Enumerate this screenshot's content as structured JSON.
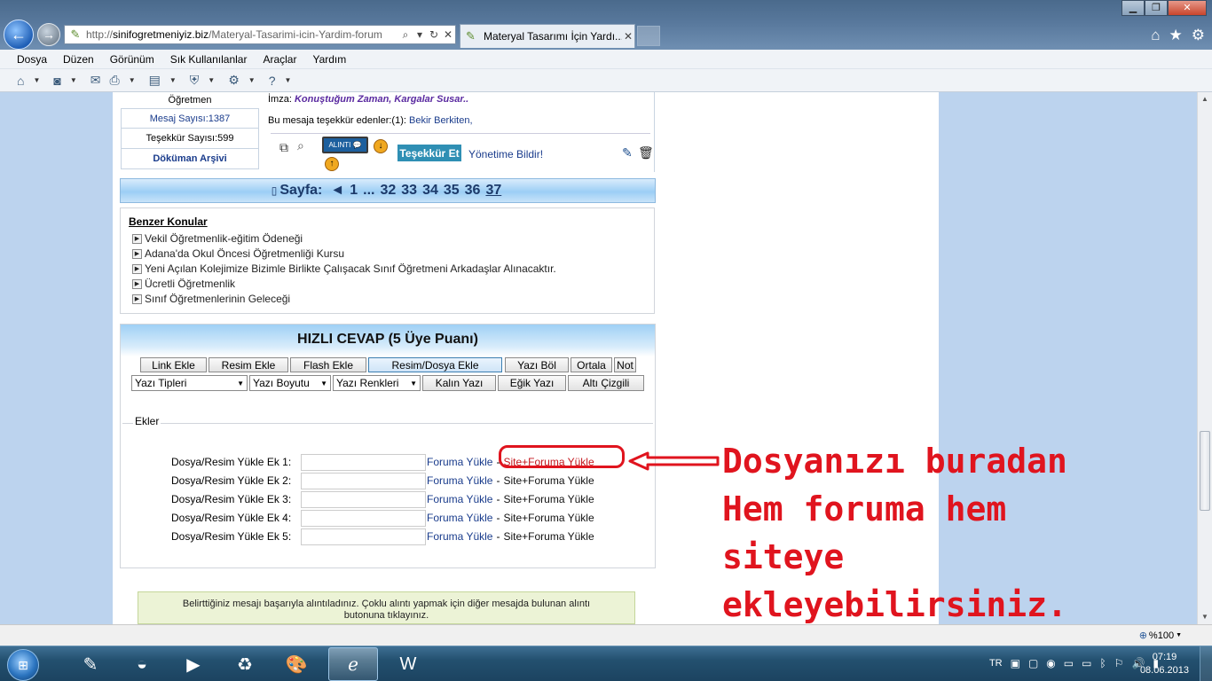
{
  "browser": {
    "url_prefix": "http://",
    "url_domain": "sinifogretmeniyiz.biz",
    "url_path": "/Materyal-Tasarimi-icin-Yardim-forum",
    "tab_title": "Materyal Tasarımı İçin Yardı...",
    "tab_close": "✕"
  },
  "menu": [
    "Dosya",
    "Düzen",
    "Görünüm",
    "Sık Kullanılanlar",
    "Araçlar",
    "Yardım"
  ],
  "post": {
    "rank": "Öğretmen",
    "message_count": "Mesaj Sayısı:1387",
    "thanks_count": "Teşekkür Sayısı:599",
    "doc_archive": "Döküman Arşivi",
    "signature_label": "İmza:",
    "signature_text": "Konuştuğum Zaman, Kargalar Susar..",
    "thanks_line": "Bu mesaja teşekkür edenler:(1):",
    "thanks_name": "Bekir Berkiten,",
    "quote_label": "ALINTI",
    "thank_button": "Teşekkür Et",
    "report_link": "Yönetime Bildir!"
  },
  "pagination": {
    "label": "Sayfa:",
    "prev": "◄",
    "first": "1",
    "ellipsis": "...",
    "pages": [
      "32",
      "33",
      "34",
      "35",
      "36"
    ],
    "current": "37"
  },
  "similar": {
    "title": "Benzer Konular",
    "items": [
      "Vekil Öğretmenlik-eğitim Ödeneği",
      "Adana'da Okul Öncesi Öğretmenliği Kursu",
      "Yeni Açılan Kolejimize Bizimle Birlikte Çalışacak Sınıf Öğretmeni Arkadaşlar Alınacaktır.",
      "Ücretli Öğretmenlik",
      "Sınıf Öğretmenlerinin Geleceği"
    ]
  },
  "quick_reply": {
    "title": "HIZLI CEVAP (5 Üye Puanı)",
    "buttons": {
      "link": "Link Ekle",
      "image": "Resim Ekle",
      "flash": "Flash Ekle",
      "upload": "Resim/Dosya Ekle",
      "split": "Yazı Böl",
      "center": "Ortala",
      "note": "Not",
      "bold": "Kalın Yazı",
      "italic": "Eğik Yazı",
      "underline": "Altı Çizgili"
    },
    "selects": {
      "font": "Yazı Tipleri",
      "size": "Yazı Boyutu",
      "color": "Yazı Renkleri"
    },
    "attachments_legend": "Ekler",
    "attachments": [
      {
        "label": "Dosya/Resim Yükle Ek 1:",
        "forum": "Foruma Yükle",
        "sep": "-",
        "site": "Site+Foruma Yükle"
      },
      {
        "label": "Dosya/Resim Yükle Ek 2:",
        "forum": "Foruma Yükle",
        "sep": "-",
        "site": "Site+Foruma Yükle"
      },
      {
        "label": "Dosya/Resim Yükle Ek 3:",
        "forum": "Foruma Yükle",
        "sep": "-",
        "site": "Site+Foruma Yükle"
      },
      {
        "label": "Dosya/Resim Yükle Ek 4:",
        "forum": "Foruma Yükle",
        "sep": "-",
        "site": "Site+Foruma Yükle"
      },
      {
        "label": "Dosya/Resim Yükle Ek 5:",
        "forum": "Foruma Yükle",
        "sep": "-",
        "site": "Site+Foruma Yükle"
      }
    ],
    "notice_line1": "Belirttiğiniz mesajı başarıyla alıntıladınız. Çoklu alıntı yapmak için diğer mesajda bulunan alıntı",
    "notice_line2": "butonuna tıklayınız."
  },
  "annotation": {
    "text": "Dosyanızı buradan\nHem foruma hem\nsiteye\nekleyebilirsiniz."
  },
  "status": {
    "zoom": "%100"
  },
  "taskbar": {
    "lang": "TR",
    "time": "07:19",
    "date": "08.06.2013"
  },
  "colors": {
    "accent_red": "#e0141e",
    "link_blue": "#1a3c8c",
    "page_bg": "#bcd3ee"
  }
}
